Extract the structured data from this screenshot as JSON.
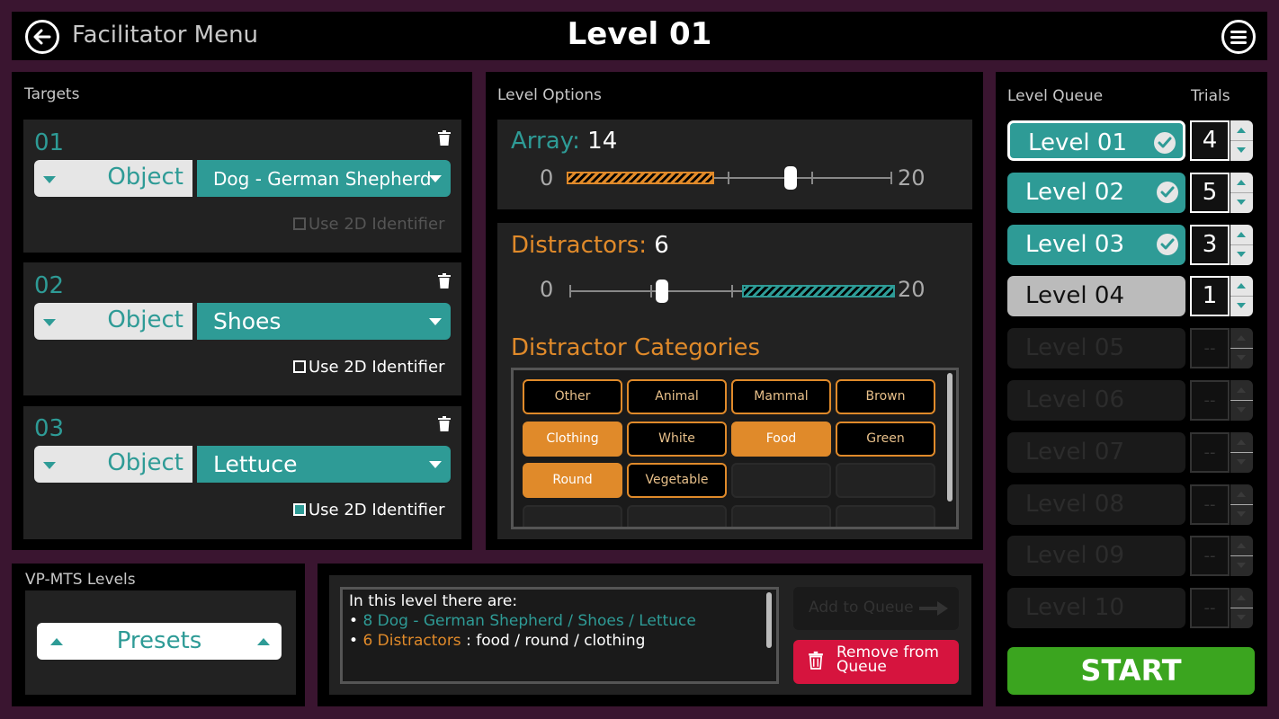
{
  "header": {
    "back_label": "Facilitator Menu",
    "title": "Level 01"
  },
  "targets": {
    "section_label": "Targets",
    "items": [
      {
        "num": "01",
        "type": "Object",
        "value": "Dog - German Shepherd",
        "identifier_label": "Use 2D Identifier",
        "identifier_state": "disabled"
      },
      {
        "num": "02",
        "type": "Object",
        "value": "Shoes",
        "identifier_label": "Use 2D Identifier",
        "identifier_state": "unchecked"
      },
      {
        "num": "03",
        "type": "Object",
        "value": "Lettuce",
        "identifier_label": "Use 2D Identifier",
        "identifier_state": "checked"
      }
    ]
  },
  "level_options": {
    "section_label": "Level Options",
    "array": {
      "label": "Array:",
      "value": "14",
      "min": "0",
      "max": "20"
    },
    "distractors": {
      "label": "Distractors:",
      "value": "6",
      "min": "0",
      "max": "20"
    },
    "categories_label": "Distractor Categories",
    "categories": [
      {
        "label": "Other",
        "selected": false
      },
      {
        "label": "Animal",
        "selected": false
      },
      {
        "label": "Mammal",
        "selected": false
      },
      {
        "label": "Brown",
        "selected": false
      },
      {
        "label": "Clothing",
        "selected": true
      },
      {
        "label": "White",
        "selected": false
      },
      {
        "label": "Food",
        "selected": true
      },
      {
        "label": "Green",
        "selected": false
      },
      {
        "label": "Round",
        "selected": true
      },
      {
        "label": "Vegetable",
        "selected": false
      }
    ]
  },
  "queue": {
    "section_label": "Level Queue",
    "trials_label": "Trials",
    "levels": [
      {
        "label": "Level 01",
        "trials": "4",
        "state": "current"
      },
      {
        "label": "Level 02",
        "trials": "5",
        "state": "done"
      },
      {
        "label": "Level 03",
        "trials": "3",
        "state": "done"
      },
      {
        "label": "Level 04",
        "trials": "1",
        "state": "pending"
      },
      {
        "label": "Level 05",
        "trials": "--",
        "state": "empty"
      },
      {
        "label": "Level 06",
        "trials": "--",
        "state": "empty"
      },
      {
        "label": "Level 07",
        "trials": "--",
        "state": "empty"
      },
      {
        "label": "Level 08",
        "trials": "--",
        "state": "empty"
      },
      {
        "label": "Level 09",
        "trials": "--",
        "state": "empty"
      },
      {
        "label": "Level 10",
        "trials": "--",
        "state": "empty"
      }
    ],
    "start_label": "START"
  },
  "vpmts": {
    "section_label": "VP-MTS Levels",
    "presets_label": "Presets"
  },
  "summary": {
    "heading": "In this level there are:",
    "bullet": "•",
    "targets_text": "8 Dog - German Shepherd / Shoes / Lettuce",
    "distractors_text": "6 Distractors",
    "distractors_detail": " : food / round / clothing",
    "add_label": "Add to Queue",
    "remove_label": "Remove from\nQueue"
  },
  "colors": {
    "teal": "#2e9b96",
    "orange": "#e08a2a",
    "start_green": "#3ba51f",
    "remove_red": "#d6143e",
    "frame": "#3a1530"
  }
}
